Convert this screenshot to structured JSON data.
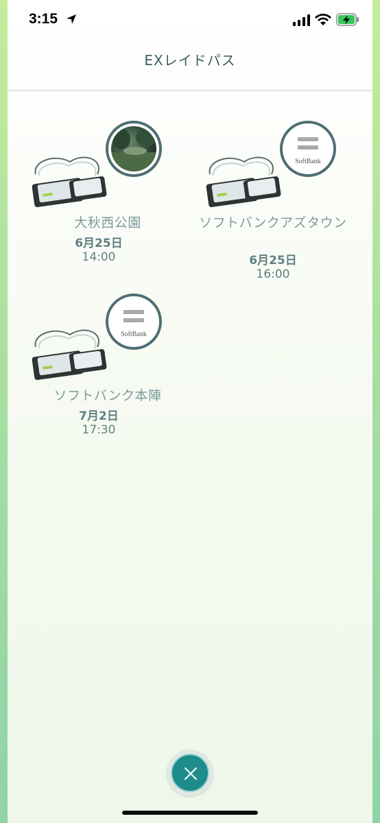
{
  "status_bar": {
    "time": "3:15",
    "icons": [
      "location-arrow-icon",
      "signal-icon",
      "wifi-icon",
      "battery-charging-icon"
    ]
  },
  "header": {
    "title": "EXレイドパス"
  },
  "passes": [
    {
      "name": "大秋西公園",
      "date": "6月25日",
      "time": "14:00",
      "badge": "gym-photo"
    },
    {
      "name": "ソフトバンクアズタウン",
      "date": "6月25日",
      "time": "16:00",
      "badge": "softbank-logo",
      "badge_text": "SoftBank"
    },
    {
      "name": "ソフトバンク本陣",
      "date": "7月2日",
      "time": "17:30",
      "badge": "softbank-logo",
      "badge_text": "SoftBank"
    }
  ],
  "close_button": {
    "icon": "close-icon"
  },
  "colors": {
    "accent": "#1f8c8c",
    "text": "#5f7f82",
    "badge_border": "#4e6e73"
  }
}
